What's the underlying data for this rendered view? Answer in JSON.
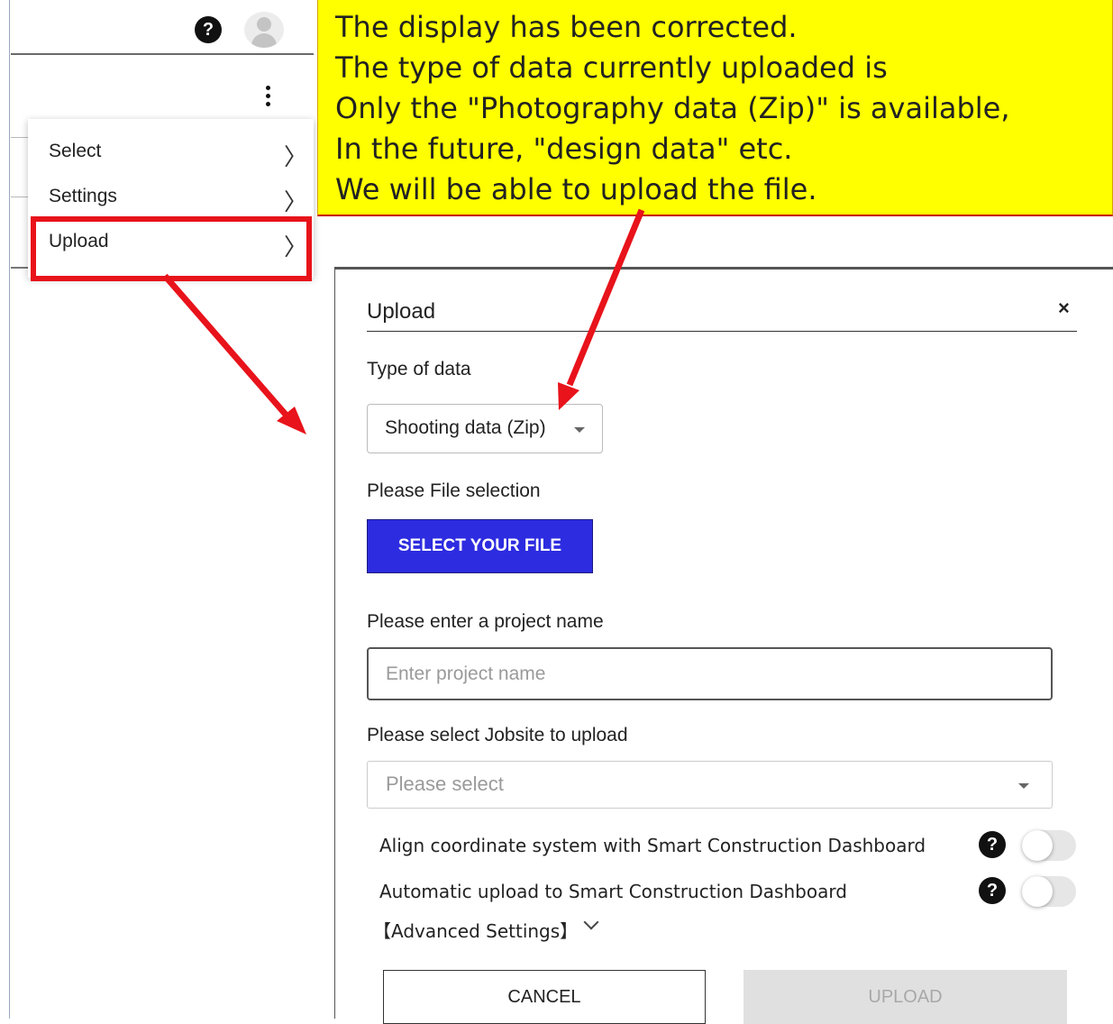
{
  "header": {
    "help_icon_glyph": "?"
  },
  "menu": {
    "items": [
      {
        "label": "Select",
        "chevron": "〉"
      },
      {
        "label": "Settings",
        "chevron": "〉"
      },
      {
        "label": "Upload",
        "chevron": "〉"
      }
    ]
  },
  "annotation": {
    "lines": [
      "The display has been corrected.",
      "The type of data currently uploaded is",
      "Only the \"Photography data (Zip)\" is available,",
      "In the future, \"design data\" etc.",
      "We will be able to upload the file."
    ],
    "highlight_color": "#e8131b",
    "note_background": "#ffff00"
  },
  "dialog": {
    "title": "Upload",
    "close_glyph": "×",
    "type_of_data_label": "Type of data",
    "type_of_data_value": "Shooting data (Zip)",
    "file_selection_label": "Please File selection",
    "select_file_button": "SELECT YOUR FILE",
    "project_name_label": "Please enter a project name",
    "project_name_placeholder": "Enter project name",
    "jobsite_label": "Please select Jobsite to upload",
    "jobsite_placeholder": "Please select",
    "align_coordinate_label": "Align coordinate system with Smart Construction Dashboard",
    "auto_upload_label": "Automatic upload to Smart Construction Dashboard",
    "advanced_settings_label": "【Advanced Settings】",
    "help_icon_glyph": "?",
    "cancel_button": "CANCEL",
    "upload_button": "UPLOAD",
    "primary_color": "#2d2ce0"
  }
}
